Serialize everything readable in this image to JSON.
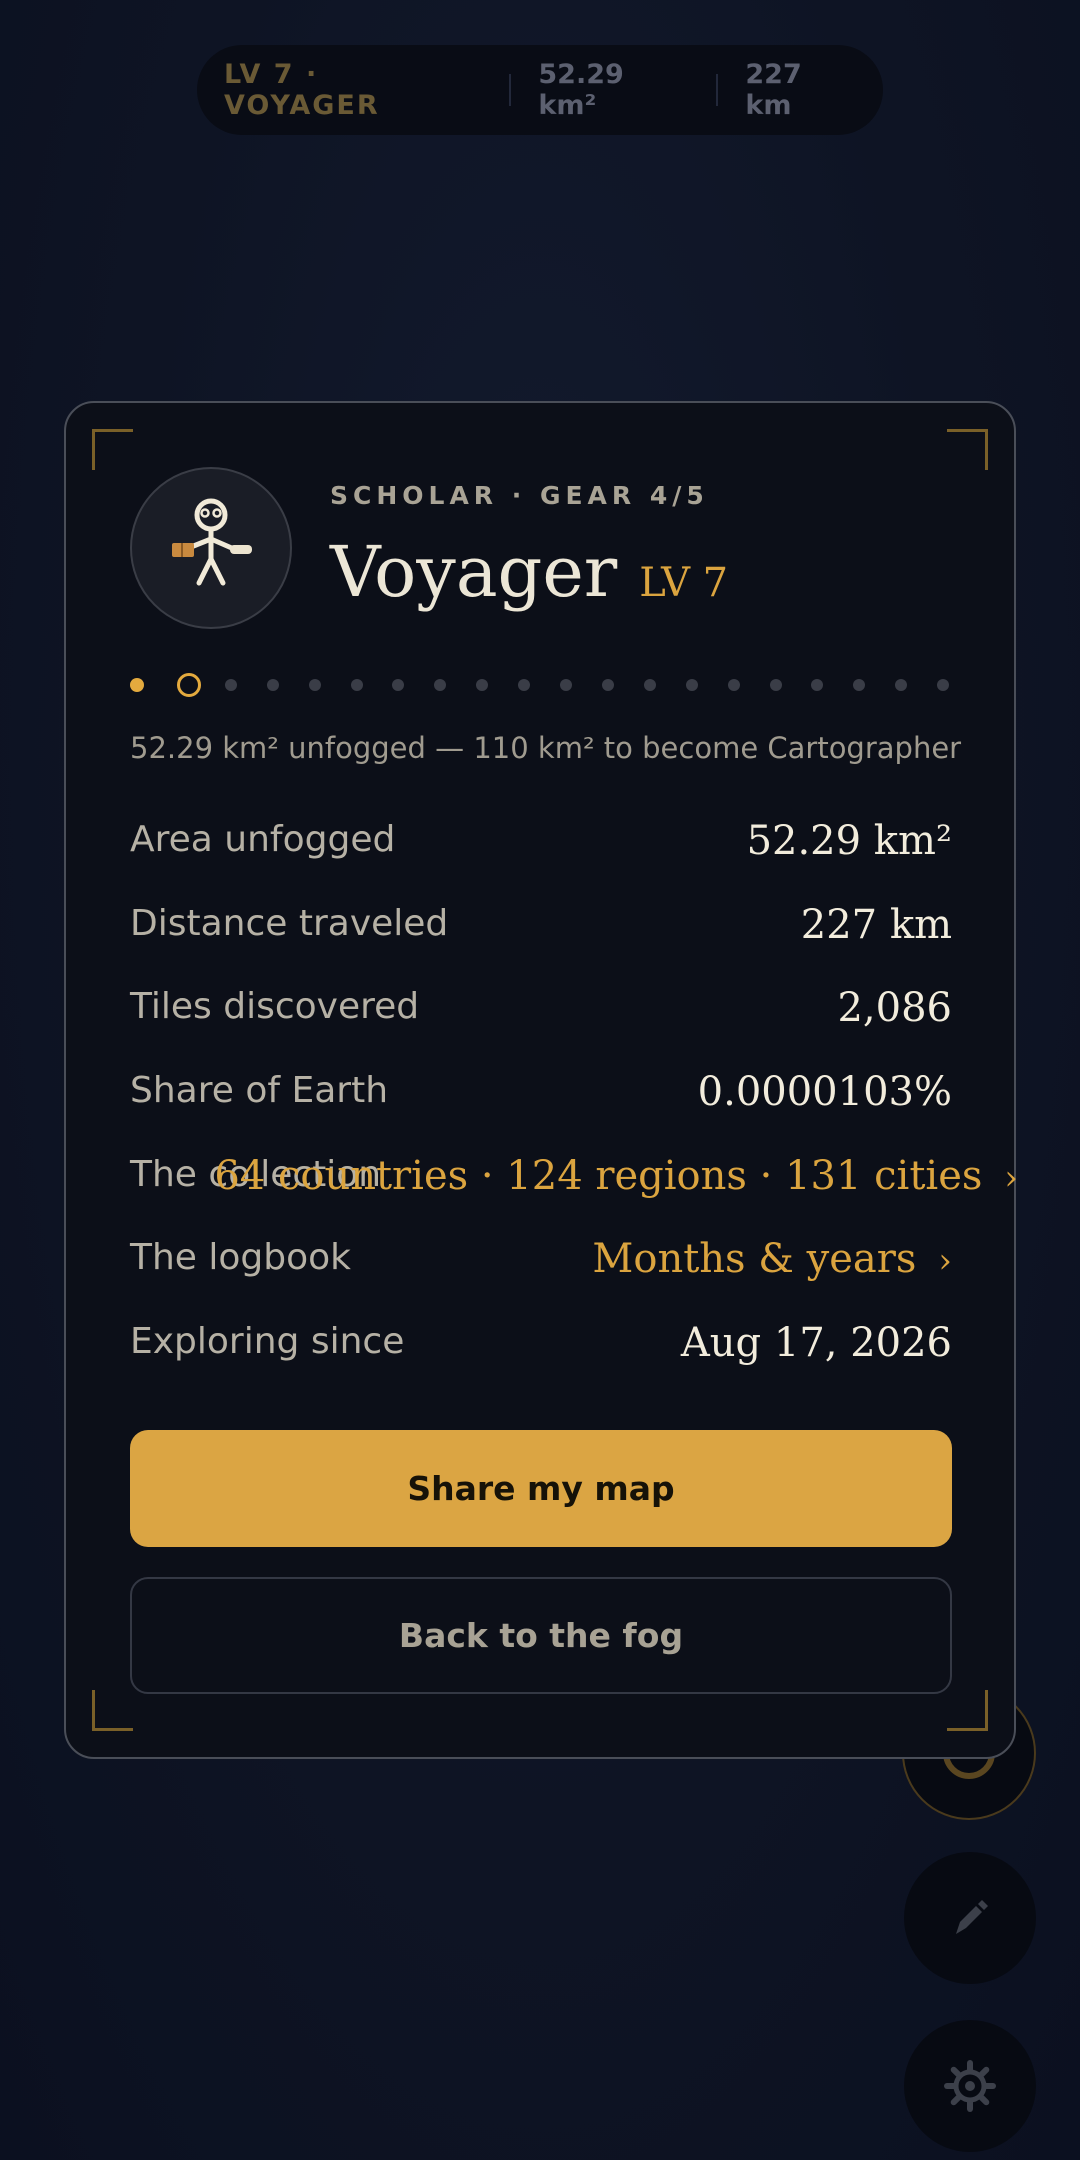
{
  "top_pill": {
    "level": "LV 7 · VOYAGER",
    "area": "52.29 km²",
    "distance": "227 km"
  },
  "card": {
    "subtitle": "SCHOLAR · GEAR 4/5",
    "title": "Voyager",
    "level_tag": "LV 7",
    "avatar_icon": "scholar-figure-icon",
    "progress": {
      "total_steps": 20,
      "completed": 1,
      "current": 2
    },
    "progress_text": "52.29 km² unfogged — 110 km² to become Cartographer",
    "stats": [
      {
        "label": "Area unfogged",
        "value": "52.29 km²"
      },
      {
        "label": "Distance traveled",
        "value": "227 km"
      },
      {
        "label": "Tiles discovered",
        "value": "2,086"
      },
      {
        "label": "Share of Earth",
        "value": "0.0000103%"
      },
      {
        "label": "The collection",
        "value": "64 countries · 124 regions · 131 cities",
        "chevron": "›"
      },
      {
        "label": "The logbook",
        "value": "Months & years",
        "chevron": "›"
      },
      {
        "label": "Exploring since",
        "value": "Aug 17, 2026"
      }
    ],
    "primary_button": "Share my map",
    "secondary_button": "Back to the fog"
  },
  "fabs": {
    "locate_icon": "locate-icon",
    "edit_icon": "pen-icon",
    "settings_icon": "gear-icon"
  },
  "colors": {
    "accent": "#dba543",
    "background": "#0e1424",
    "card": "#0c0f18"
  }
}
